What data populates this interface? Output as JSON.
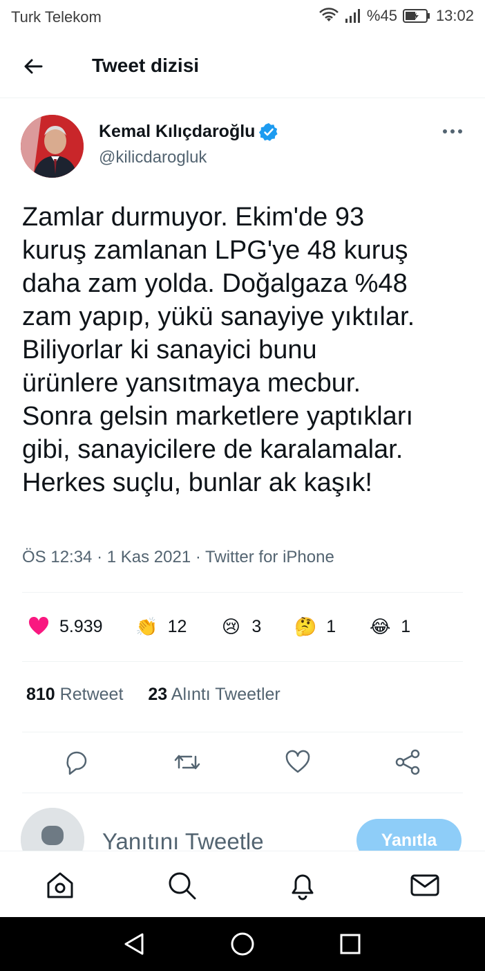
{
  "status_bar": {
    "carrier": "Turk Telekom",
    "battery": "%45",
    "time": "13:02"
  },
  "header": {
    "title": "Tweet dizisi"
  },
  "author": {
    "name": "Kemal Kılıçdaroğlu",
    "handle": "@kilicdarogluk"
  },
  "tweet": {
    "text": "Zamlar durmuyor. Ekim'de 93\nkuruş zamlanan LPG'ye 48 kuruş\ndaha zam yolda. Doğalgaza %48\nzam yapıp, yükü sanayiye yıktılar.\nBiliyorlar ki sanayici bunu\nürünlere yansıtmaya mecbur.\nSonra gelsin marketlere yaptıkları\ngibi, sanayicilere de karalamalar.\nHerkes suçlu, bunlar ak kaşık!",
    "meta": "ÖS 12:34 · 1 Kas 2021 · Twitter for iPhone"
  },
  "reactions": [
    {
      "emoji": "❤",
      "count": "5.939"
    },
    {
      "emoji": "👏",
      "count": "12"
    },
    {
      "emoji": "😢",
      "count": "3"
    },
    {
      "emoji": "🤔",
      "count": "1"
    },
    {
      "emoji": "😂",
      "count": "1"
    }
  ],
  "stats": {
    "retweet_count": "810",
    "retweet_label": "Retweet",
    "quote_count": "23",
    "quote_label": "Alıntı Tweetler"
  },
  "reply": {
    "placeholder": "Yanıtını Tweetle",
    "button_label": "Yanıtla"
  },
  "colors": {
    "accent": "#1d9bf0",
    "verified": "#1d9bf0",
    "reply_button": "#8ecdf8",
    "heart": "#f91880",
    "secondary_text": "#536471"
  },
  "icons": {
    "back": "arrow-left-icon",
    "more": "more-horizontal-icon",
    "reply": "comment-icon",
    "retweet": "retweet-icon",
    "like": "heart-icon",
    "share": "share-icon",
    "home": "home-icon",
    "search": "search-icon",
    "notifications": "bell-icon",
    "messages": "mail-icon"
  }
}
